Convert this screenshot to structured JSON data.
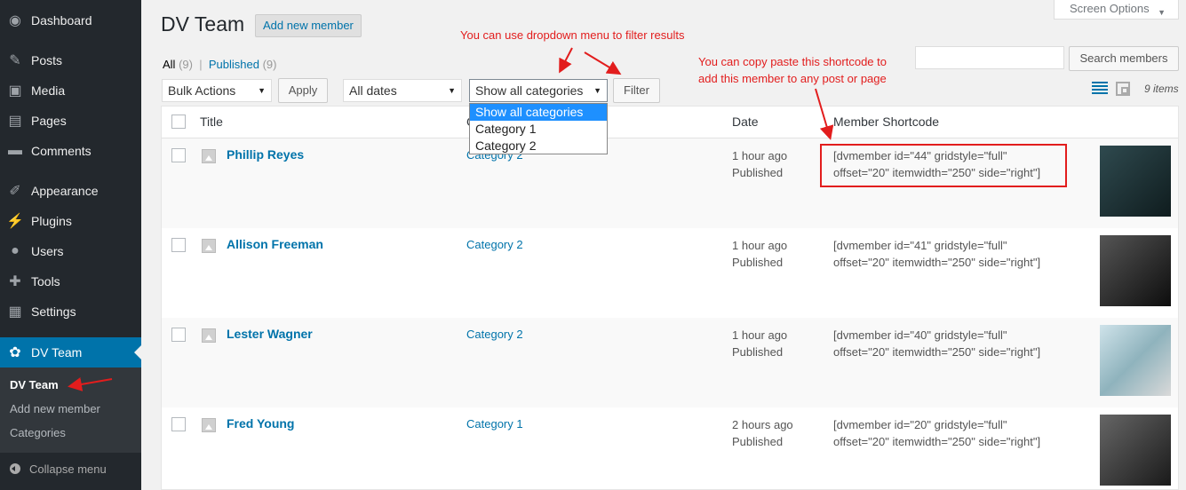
{
  "sidebar": {
    "items": [
      {
        "label": "Dashboard",
        "icon": "dashboard-icon",
        "glyph": "◉"
      },
      {
        "label": "Posts",
        "icon": "pin-icon",
        "glyph": "✎"
      },
      {
        "label": "Media",
        "icon": "media-icon",
        "glyph": "▣"
      },
      {
        "label": "Pages",
        "icon": "pages-icon",
        "glyph": "▤"
      },
      {
        "label": "Comments",
        "icon": "comment-icon",
        "glyph": "▬"
      },
      {
        "label": "Appearance",
        "icon": "brush-icon",
        "glyph": "✐"
      },
      {
        "label": "Plugins",
        "icon": "plugin-icon",
        "glyph": "⚡"
      },
      {
        "label": "Users",
        "icon": "user-icon",
        "glyph": "●"
      },
      {
        "label": "Tools",
        "icon": "wrench-icon",
        "glyph": "✚"
      },
      {
        "label": "Settings",
        "icon": "settings-icon",
        "glyph": "▦"
      },
      {
        "label": "DV Team",
        "icon": "team-icon",
        "glyph": "✿"
      }
    ],
    "submenu": [
      "DV Team",
      "Add new member",
      "Categories"
    ],
    "collapse": "Collapse menu"
  },
  "header": {
    "title": "DV Team",
    "add_new": "Add new member",
    "screen_options": "Screen Options"
  },
  "filters": {
    "all": "All",
    "all_count": "(9)",
    "published": "Published",
    "published_count": "(9)",
    "separator": "|",
    "bulk_actions": "Bulk Actions",
    "apply": "Apply",
    "all_dates": "All dates",
    "categories_selected": "Show all categories",
    "filter": "Filter",
    "dropdown_options": [
      "Show all categories",
      "Category 1",
      "Category 2"
    ],
    "search_placeholder": "",
    "search_button": "Search members",
    "items_count": "9 items"
  },
  "table": {
    "columns": [
      "Title",
      "C",
      "Date",
      "Member Shortcode"
    ],
    "rows": [
      {
        "name": "Phillip Reyes",
        "category": "Category 2",
        "time": "1 hour ago",
        "status": "Published",
        "sc1": "[dvmember id=\"44\" gridstyle=\"full\"",
        "sc2": "offset=\"20\" itemwidth=\"250\" side=\"right\"]"
      },
      {
        "name": "Allison Freeman",
        "category": "Category 2",
        "time": "1 hour ago",
        "status": "Published",
        "sc1": "[dvmember id=\"41\" gridstyle=\"full\"",
        "sc2": "offset=\"20\" itemwidth=\"250\" side=\"right\"]"
      },
      {
        "name": "Lester Wagner",
        "category": "Category 2",
        "time": "1 hour ago",
        "status": "Published",
        "sc1": "[dvmember id=\"40\" gridstyle=\"full\"",
        "sc2": "offset=\"20\" itemwidth=\"250\" side=\"right\"]"
      },
      {
        "name": "Fred Young",
        "category": "Category 1",
        "time": "2 hours ago",
        "status": "Published",
        "sc1": "[dvmember id=\"20\" gridstyle=\"full\"",
        "sc2": "offset=\"20\" itemwidth=\"250\" side=\"right\"]"
      }
    ]
  },
  "annotations": {
    "dropdown_note": "You can use dropdown menu to filter results",
    "shortcode_note_1": "You can copy paste this shortcode to",
    "shortcode_note_2": "add this member to any post or page",
    "color": "#e21d1d"
  },
  "colors": {
    "sidebar_bg": "#23282d",
    "accent": "#0073aa",
    "link": "#0073aa"
  }
}
